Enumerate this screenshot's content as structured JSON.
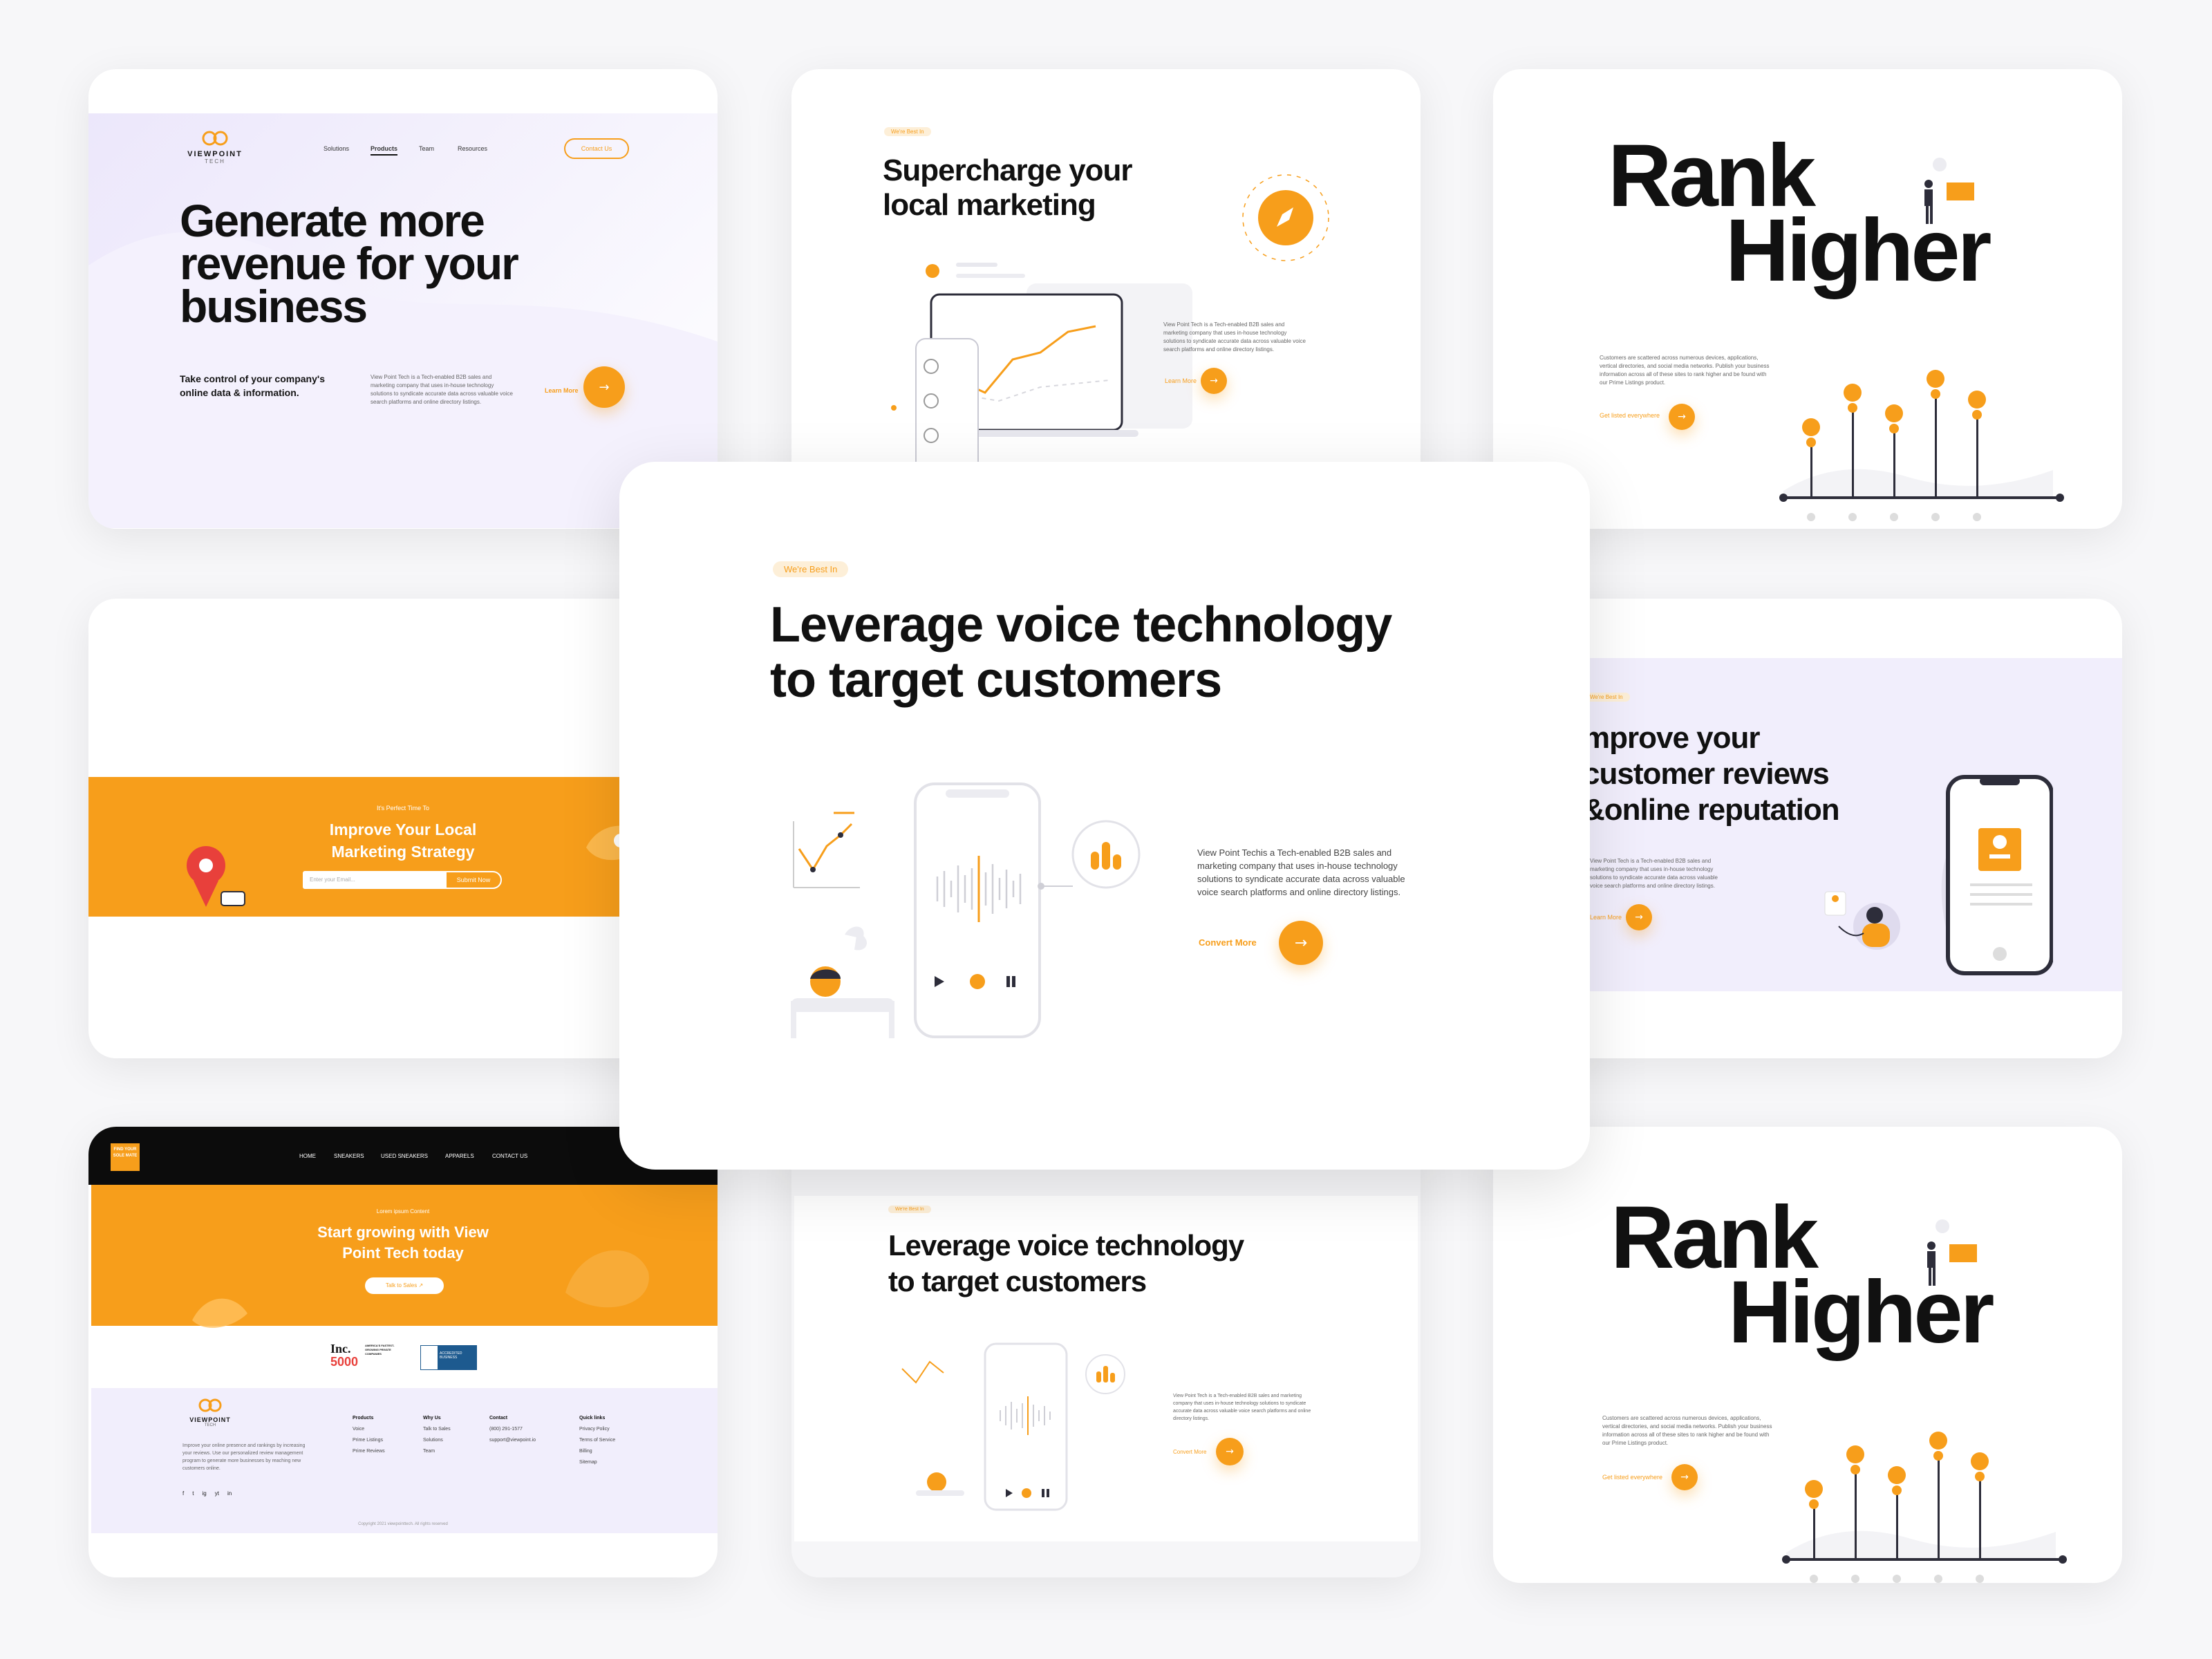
{
  "card1": {
    "logo": "VIEWPOINT",
    "logo_sub": "TECH",
    "nav": [
      "Solutions",
      "Products",
      "Team",
      "Resources"
    ],
    "contact_btn": "Contact Us",
    "headline_lines": [
      "Generate more",
      "revenue for your",
      "business"
    ],
    "sub_lines": [
      "Take control of your company's",
      "online data & information."
    ],
    "body": "View Point Tech is a Tech-enabled B2B sales and marketing company that uses in-house technology solutions to syndicate accurate data across valuable voice search platforms and online directory listings.",
    "cta": "Learn More"
  },
  "card2": {
    "badge": "We're Best In",
    "headline_lines": [
      "Supercharge your",
      "local marketing"
    ],
    "body": "View Point Tech is a Tech-enabled B2B sales and marketing company that uses in-house technology solutions to syndicate accurate data across valuable voice search platforms and online directory listings.",
    "cta": "Learn More"
  },
  "card3": {
    "headline_lines": [
      "Rank",
      "Higher"
    ],
    "body": "Customers are scattered across numerous devices, applications, vertical directories, and social media networks. Publish your business information across all of these sites to rank higher and be found with our Prime Listings product.",
    "cta": "Get listed everywhere"
  },
  "card4": {
    "eyebrow": "It's Perfect Time To",
    "headline_lines": [
      "Improve Your Local",
      "Marketing Strategy"
    ],
    "email_placeholder": "Enter your Email...",
    "submit": "Submit Now"
  },
  "card5": {
    "badge": "We're Best In",
    "headline_lines": [
      "mprove your",
      "customer reviews",
      "&online reputation"
    ],
    "body": "View Point Tech is a Tech-enabled B2B sales and marketing company that uses in-house technology solutions to syndicate accurate data across valuable voice search platforms and online directory listings.",
    "cta": "Learn More"
  },
  "card6": {
    "logo_text": "FIND YOUR SOLE MATE",
    "nav": [
      "HOME",
      "SNEAKERS",
      "USED SNEAKERS",
      "APPARELS",
      "CONTACT US"
    ],
    "eyebrow": "Lorem ipsum Content",
    "headline_lines": [
      "Start growing with View",
      "Point Tech today"
    ],
    "cta": "Talk to Sales",
    "inc_top": "Inc.",
    "inc_num": "5000",
    "inc_label": "AMERICA'S FASTEST-GROWING PRIVATE COMPANIES",
    "bbb": "ACCREDITED BUSINESS",
    "footer_logo": "VIEWPOINT",
    "footer_logo_sub": "TECH",
    "footer_about": "Improve your online presence and rankings by increasing your reviews. Use our personalized review management program to generate more businesses by reaching new customers online.",
    "cols": [
      {
        "title": "Products",
        "items": [
          "Voice",
          "Prime Listings",
          "Prime Reviews"
        ]
      },
      {
        "title": "Why Us",
        "items": [
          "Talk to Sales",
          "Solutions",
          "Team"
        ]
      },
      {
        "title": "Contact",
        "items": [
          "(800) 291-1577",
          "support@viewpoint.io"
        ]
      },
      {
        "title": "Quick links",
        "items": [
          "Privacy Policy",
          "Terms of Service",
          "Billing",
          "Sitemap"
        ]
      }
    ],
    "social": [
      "f",
      "t",
      "ig",
      "yt",
      "in"
    ],
    "copyright": "Copyright 2021 viewpointtech. All rights reserved"
  },
  "card7": {
    "badge": "We're Best In",
    "headline_lines": [
      "Leverage voice technology",
      "to target customers"
    ],
    "body": "View Point Tech is a Tech-enabled B2B sales and marketing company that uses in-house technology solutions to syndicate accurate data across valuable voice search platforms and online directory listings.",
    "cta": "Convert More"
  },
  "card8": {
    "headline_lines": [
      "Rank",
      "Higher"
    ],
    "body": "Customers are scattered across numerous devices, applications, vertical directories, and social media networks. Publish your business information across all of these sites to rank higher and be found with our Prime Listings product.",
    "cta": "Get listed everywhere"
  },
  "center": {
    "badge": "We're Best In",
    "headline_lines": [
      "Leverage voice technology",
      "to target customers"
    ],
    "body_lines": [
      "View Point Techis a Tech-enabled B2B sales and",
      "marketing company that uses in-house technology",
      "solutions to syndicate accurate data across valuable",
      "voice search platforms and online directory listings."
    ],
    "cta": "Convert More"
  },
  "colors": {
    "accent": "#f79e1b",
    "dark": "#141414",
    "lavender": "#f1eefc"
  },
  "icons": [
    "arrow-right-icon",
    "rocket-icon",
    "play-icon",
    "pause-icon",
    "location-pin-icon",
    "phone-icon",
    "bar-chart-icon",
    "soundwave-icon"
  ]
}
